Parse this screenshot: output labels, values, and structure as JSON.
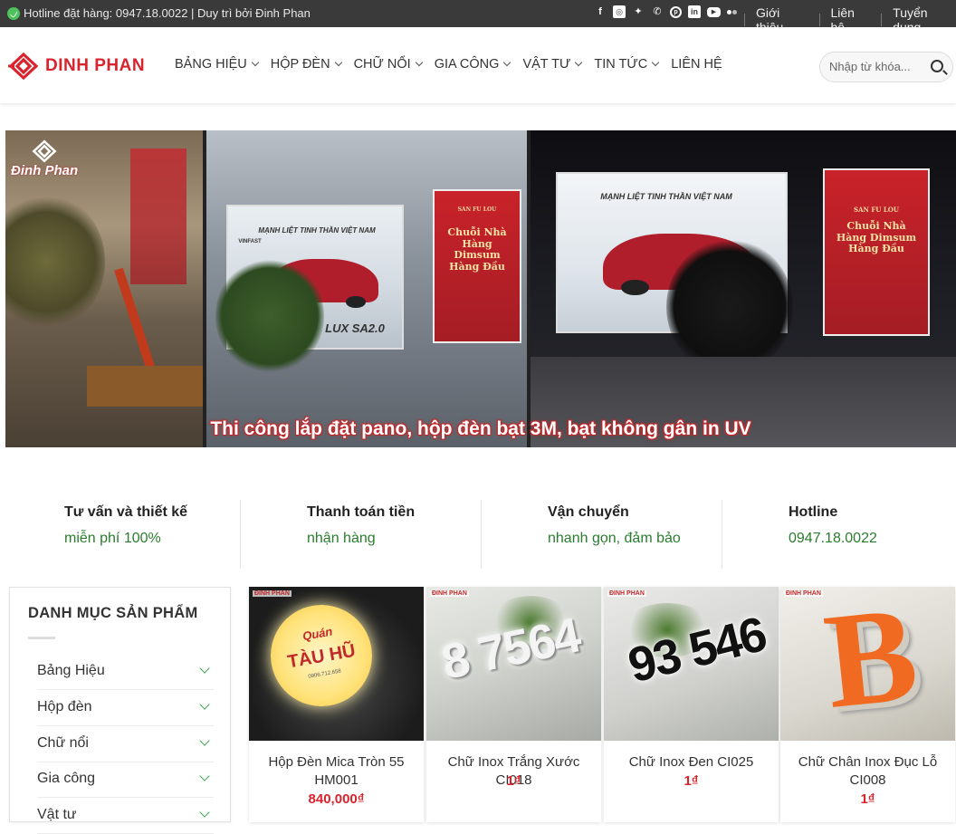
{
  "topbar": {
    "hotline_text": "Hotline đặt hàng: 0947.18.0022 | Duy trì bởi Đinh Phan",
    "social_icons": [
      "facebook-icon",
      "instagram-icon",
      "twitter-icon",
      "phone-icon",
      "pinterest-icon",
      "linkedin-icon",
      "youtube-icon",
      "flickr-icon"
    ],
    "links": [
      "Giới thiệu",
      "Liên hệ",
      "Tuyển dụng"
    ]
  },
  "header": {
    "logo_text": "DINH PHAN",
    "nav": [
      "BẢNG HIỆU",
      "HỘP ĐÈN",
      "CHỮ NỔI",
      "GIA CÔNG",
      "VẬT TƯ",
      "TIN TỨC",
      "LIÊN HỆ"
    ],
    "search_placeholder": "Nhập từ khóa..."
  },
  "banner": {
    "caption": "Thi công lắp đặt pano, hộp đèn bạt 3M, bạt không gân in UV",
    "watermark": "Đinh Phan",
    "billboard_car_slogan": "MẠNH LIỆT TINH THẦN VIỆT NAM",
    "billboard_car_brand": "VINFAST",
    "billboard_car_model": "LUX SA2.0",
    "billboard_red_brand": "SAN FU LOU",
    "billboard_red_text": "Chuỗi Nhà Hàng Dimsum Hàng Đầu"
  },
  "features": [
    {
      "title": "Tư vấn và thiết kế",
      "subtitle": "miễn phí 100%"
    },
    {
      "title": "Thanh toán tiền",
      "subtitle": "nhận hàng"
    },
    {
      "title": "Vận chuyển",
      "subtitle": "nhanh gọn, đảm bảo"
    },
    {
      "title": "Hotline",
      "subtitle": "0947.18.0022"
    }
  ],
  "sidebar": {
    "title": "DANH MỤC SẢN PHẨM",
    "categories": [
      "Bảng Hiệu",
      "Hộp đèn",
      "Chữ nổi",
      "Gia công",
      "Vật tư"
    ]
  },
  "products": [
    {
      "name": "Hộp Đèn Mica Tròn 55 HM001",
      "price": "840,000₫",
      "img_text_top": "Quán",
      "img_text_main": "TÀU HŨ",
      "img_text_sub": "0906.712.658"
    },
    {
      "name": "Chữ Inox Trắng Xước CI018",
      "price": "1₫",
      "img_text": "8 7564"
    },
    {
      "name": "Chữ Inox Đen CI025",
      "price": "1₫",
      "img_text": "93 546"
    },
    {
      "name": "Chữ Chân Inox Đục Lỗ CI008",
      "price": "1₫",
      "img_text": "B"
    }
  ],
  "product_tag": "ĐINH PHAN",
  "colors": {
    "brand_red": "#d9232d",
    "green": "#2a7d2e",
    "topbar": "#3a3a3a"
  }
}
